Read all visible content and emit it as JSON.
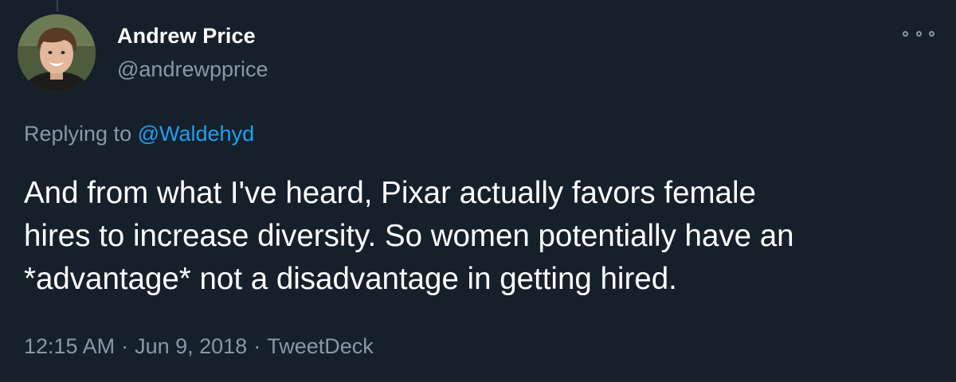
{
  "author": {
    "name": "Andrew Price",
    "handle": "@andrewpprice"
  },
  "reply": {
    "prefix": "Replying to",
    "mention": "@Waldehyd"
  },
  "tweet": {
    "lines": [
      "And from what I've heard, Pixar actually favors female",
      "hires to increase diversity. So women potentially have an",
      "*advantage* not a disadvantage in getting hired."
    ]
  },
  "meta": {
    "time": "12:15 AM",
    "date": "Jun 9, 2018",
    "separator": "·",
    "source": "TweetDeck"
  },
  "icons": {
    "more": "more-options-icon",
    "avatar": "profile-photo"
  },
  "colors": {
    "background": "#15202b",
    "secondary_text": "#8899a6",
    "link": "#1da1f2"
  }
}
